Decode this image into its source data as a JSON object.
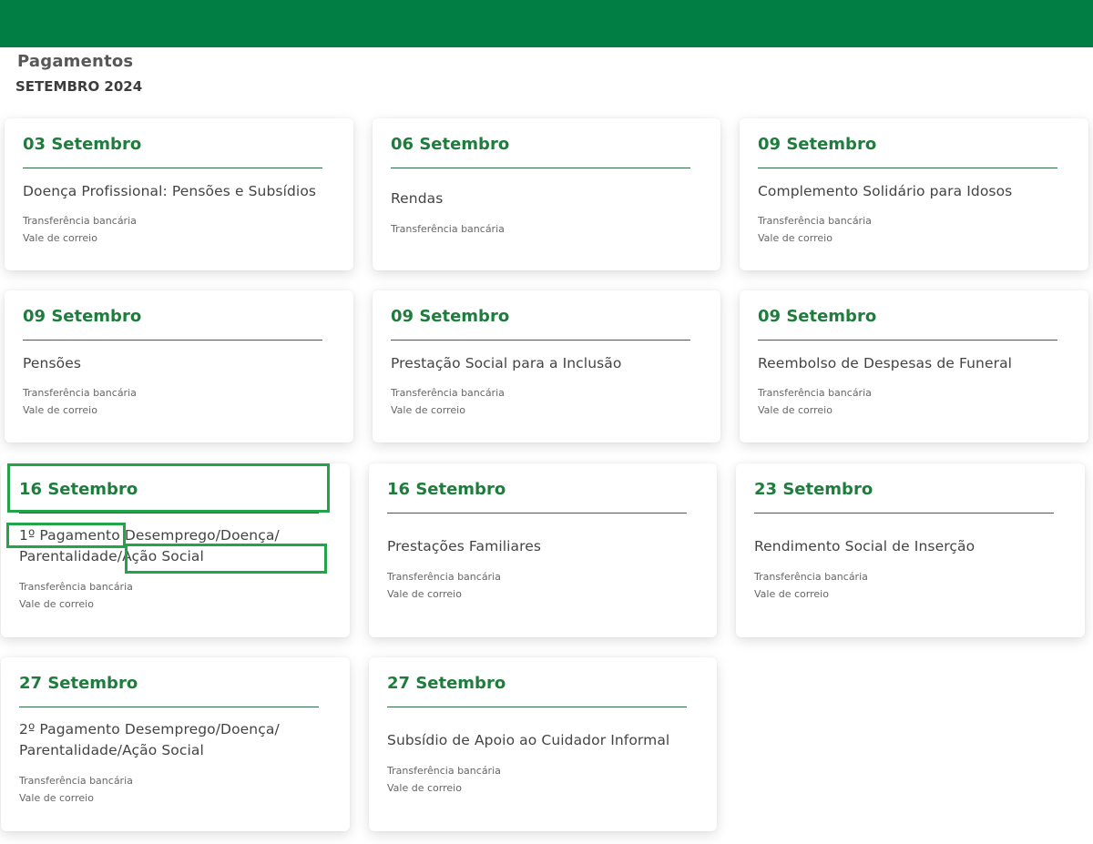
{
  "header": {
    "title": "Pagamentos",
    "subtitle": "SETEMBRO 2024"
  },
  "colors": {
    "topbar": "#007e44",
    "date_text": "#1e7d3d",
    "highlight_box": "#22a54a"
  },
  "payment_methods": {
    "bank": "Transferência bancária",
    "mail": "Vale de correio"
  },
  "cards": [
    {
      "date": "03 Setembro",
      "title": "Doença Profissional: Pensões e Subsídios",
      "methods": [
        "Transferência bancária",
        "Vale de correio"
      ]
    },
    {
      "date": "06 Setembro",
      "title": "Rendas",
      "methods": [
        "Transferência bancária"
      ]
    },
    {
      "date": "09 Setembro",
      "title": "Complemento Solidário para Idosos",
      "methods": [
        "Transferência bancária",
        "Vale de correio"
      ]
    },
    {
      "date": "09 Setembro",
      "title": "Pensões",
      "methods": [
        "Transferência bancária",
        "Vale de correio"
      ]
    },
    {
      "date": "09 Setembro",
      "title": "Prestação Social para a Inclusão",
      "methods": [
        "Transferência bancária",
        "Vale de correio"
      ]
    },
    {
      "date": "09 Setembro",
      "title": "Reembolso de Despesas de Funeral",
      "methods": [
        "Transferência bancária",
        "Vale de correio"
      ]
    },
    {
      "date": "16 Setembro",
      "title": "1º Pagamento Desemprego/Doença/ Parentalidade/Ação Social",
      "methods": [
        "Transferência bancária",
        "Vale de correio"
      ]
    },
    {
      "date": "16 Setembro",
      "title": "Prestações Familiares",
      "methods": [
        "Transferência bancária",
        "Vale de correio"
      ]
    },
    {
      "date": "23 Setembro",
      "title": "Rendimento Social de Inserção",
      "methods": [
        "Transferência bancária",
        "Vale de correio"
      ]
    },
    {
      "date": "27 Setembro",
      "title": "2º Pagamento Desemprego/Doença/ Parentalidade/Ação Social",
      "methods": [
        "Transferência bancária",
        "Vale de correio"
      ]
    },
    {
      "date": "27 Setembro",
      "title": "Subsídio de Apoio ao Cuidador Informal",
      "methods": [
        "Transferência bancária",
        "Vale de correio"
      ]
    }
  ]
}
